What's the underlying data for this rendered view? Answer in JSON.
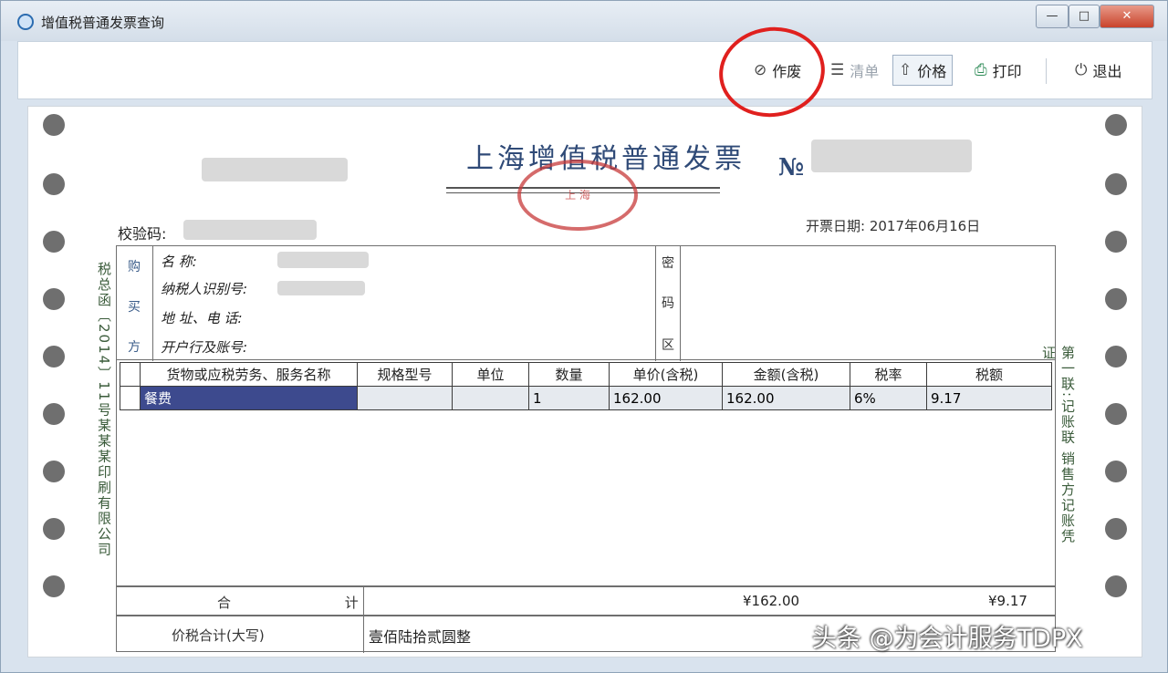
{
  "window": {
    "title": "增值税普通发票查询",
    "min_label": "—",
    "max_label": "□",
    "close_label": "✕"
  },
  "toolbar": {
    "void_label": "作废",
    "clear_list_label": "清单",
    "price_label": "价格",
    "print_label": "打印",
    "exit_label": "退出"
  },
  "invoice": {
    "title": "上海增值税普通发票",
    "no_label": "№",
    "check_code_label": "校验码:",
    "date_label": "开票日期: 2017年06月16日",
    "seal_text": "上 海",
    "left_margin_text": "税总函〔2014〕11号某某某印刷有限公司",
    "right_margin_text": "第一联:记账联 销售方记账凭证",
    "buyer": {
      "caption": [
        "购",
        "买",
        "方"
      ],
      "name_label": "名 称:",
      "tax_id_label": "纳税人识别号:",
      "address_label": "地 址、电 话:",
      "bank_label": "开户行及账号:"
    },
    "cipher_area": [
      "密",
      "码",
      "区"
    ],
    "goods": {
      "headers": [
        "货物或应税劳务、服务名称",
        "规格型号",
        "单位",
        "数量",
        "单价(含税)",
        "金额(含税)",
        "税率",
        "税额"
      ],
      "rows": [
        [
          "餐费",
          "",
          "",
          "1",
          "162.00",
          "162.00",
          "6%",
          "9.17"
        ]
      ]
    },
    "total_label": "合 计",
    "total_amount": "¥162.00",
    "total_tax": "¥9.17",
    "tax_total_label": "价税合计(大写)",
    "tax_total_value": "壹佰陆拾贰圆整"
  },
  "watermark": "头条 @为会计服务TDPX"
}
